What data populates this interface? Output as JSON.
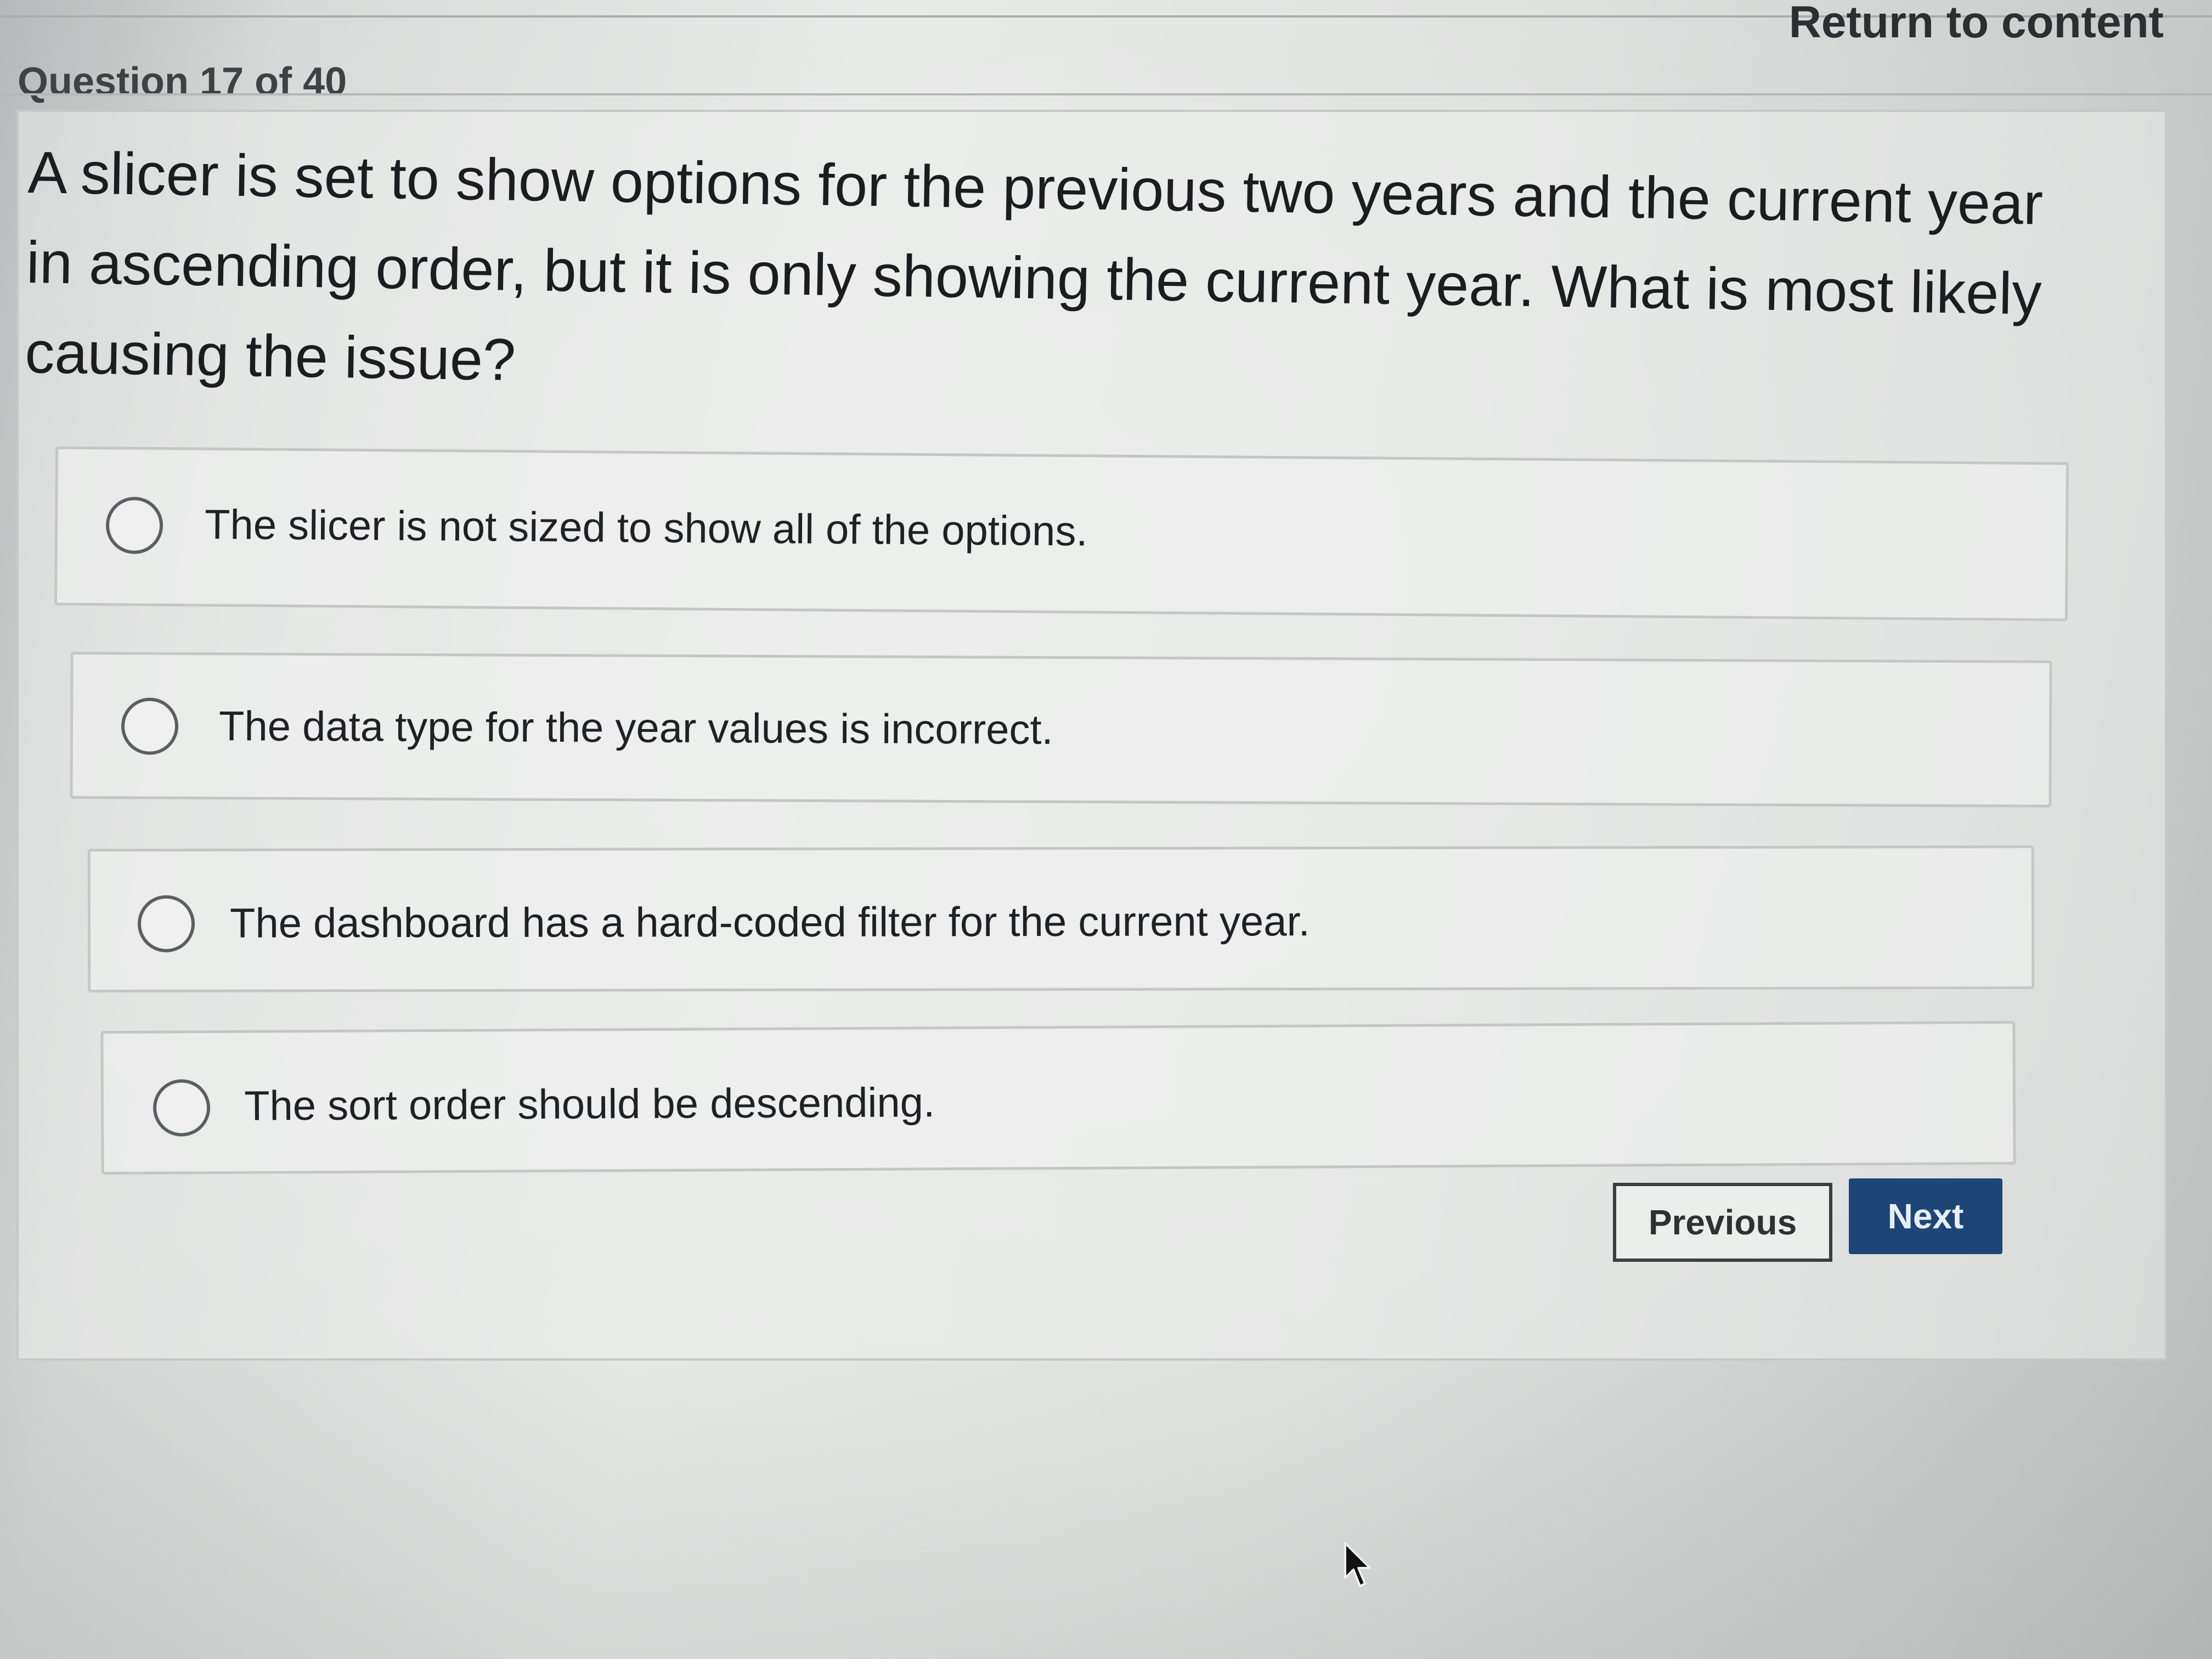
{
  "header": {
    "return_link": "Return to content",
    "question_counter": "Question 17 of 40"
  },
  "question": {
    "text": "A slicer is set to show options for the previous two years and the current year in ascending order, but it is only showing the current year. What is most likely causing the issue?"
  },
  "options": [
    {
      "label": "The slicer is not sized to show all of the options.",
      "selected": false
    },
    {
      "label": "The data type for the year values is incorrect.",
      "selected": false
    },
    {
      "label": "The dashboard has a hard-coded filter for the current year.",
      "selected": false
    },
    {
      "label": "The sort order should be descending.",
      "selected": false
    }
  ],
  "navigation": {
    "previous_label": "Previous",
    "next_label": "Next"
  },
  "colors": {
    "next_button": "#1d4677",
    "text": "#1f2326"
  },
  "icons": {
    "radio": "radio-unchecked-icon",
    "cursor": "mouse-pointer-icon"
  }
}
